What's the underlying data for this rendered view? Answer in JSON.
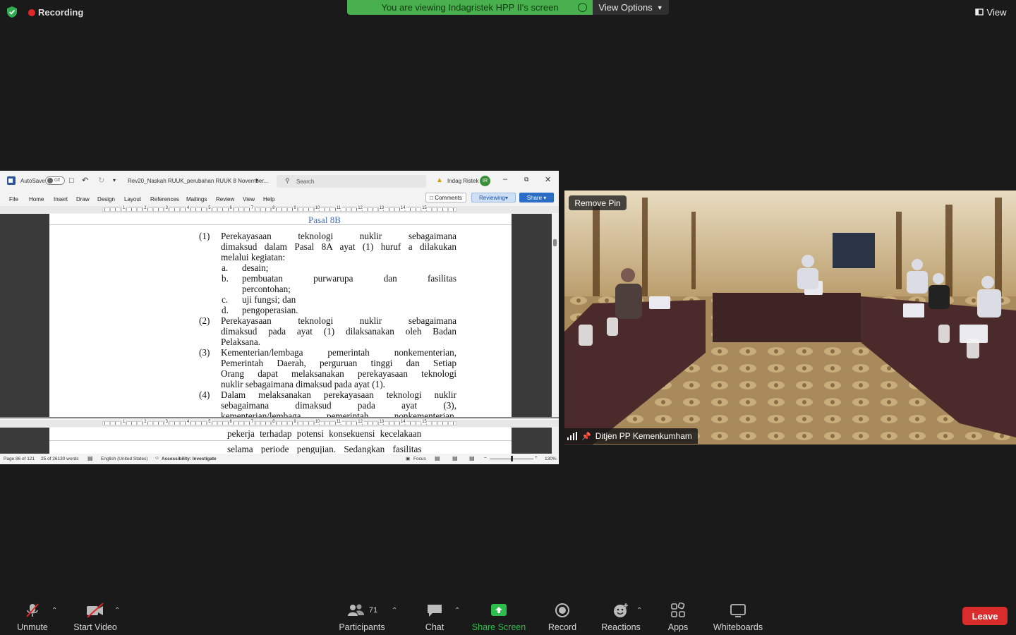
{
  "top": {
    "recording": "Recording",
    "banner": "You are viewing Indagristek HPP II's screen",
    "view_options": "View Options",
    "view": "View"
  },
  "word": {
    "autosave_label": "AutoSave",
    "autosave_state": "Off",
    "doc_title": "Rev20_Naskah RUUK_perubahan RUUK 8 November...",
    "search_placeholder": "Search",
    "user_name": "Indag Ristek",
    "user_initial": "IR",
    "menu": [
      "File",
      "Home",
      "Insert",
      "Draw",
      "Design",
      "Layout",
      "References",
      "Mailings",
      "Review",
      "View",
      "Help"
    ],
    "comments": "Comments",
    "reviewing": "Reviewing",
    "share": "Share",
    "ruler_numbers": [
      "1",
      "2",
      "3",
      "4",
      "5",
      "6",
      "7",
      "8",
      "9",
      "10",
      "11",
      "12",
      "13",
      "14",
      "15"
    ],
    "heading": "Pasal 8B",
    "lower_pane": [
      "pekerja terhadap potensi konsekuensi kecelakaan",
      "selama periode pengujian. Sedangkan fasilitas"
    ],
    "status": {
      "page": "Page 86 of 121",
      "words": "25 of 26130 words",
      "language": "English (United States)",
      "accessibility": "Accessibility: Investigate",
      "focus": "Focus",
      "zoom": "130%"
    }
  },
  "doc_lines": [
    {
      "n": "(1)",
      "t": "Perekayasaan teknologi nuklir sebagaimana",
      "j": true
    },
    {
      "n": "",
      "t": "dimaksud dalam Pasal 8A ayat (1) huruf a dilakukan",
      "j": true
    },
    {
      "n": "",
      "t": "melalui kegiatan:",
      "j": false
    },
    {
      "n": "",
      "l": "a.",
      "t": "desain;",
      "j": false
    },
    {
      "n": "",
      "l": "b.",
      "t": "pembuatan purwarupa dan fasilitas",
      "j": true
    },
    {
      "n": "",
      "l": "",
      "t": "percontohan;",
      "j": false
    },
    {
      "n": "",
      "l": "c.",
      "t": "uji fungsi; dan",
      "j": false
    },
    {
      "n": "",
      "l": "d.",
      "t": "pengoperasian.",
      "j": false
    },
    {
      "n": "(2)",
      "t": "Perekayasaan teknologi nuklir sebagaimana",
      "j": true
    },
    {
      "n": "",
      "t": "dimaksud pada ayat (1) dilaksanakan oleh Badan",
      "j": true
    },
    {
      "n": "",
      "t": "Pelaksana.",
      "j": false
    },
    {
      "n": "(3)",
      "t": "Kementerian/lembaga pemerintah nonkementerian,",
      "j": true
    },
    {
      "n": "",
      "t": "Pemerintah Daerah, perguruan tinggi dan Setiap",
      "j": true
    },
    {
      "n": "",
      "t": "Orang dapat melaksanakan perekayasaan teknologi",
      "j": true
    },
    {
      "n": "",
      "t": "nuklir sebagaimana dimaksud pada ayat (1).",
      "j": false
    },
    {
      "n": "(4)",
      "t": "Dalam melaksanakan perekayasaan teknologi nuklir",
      "j": true
    },
    {
      "n": "",
      "t": "sebagaimana dimaksud pada ayat (3),",
      "j": true
    },
    {
      "n": "",
      "t": "kementerian/lembaga pemerintah nonkementerian,",
      "j": true
    }
  ],
  "video": {
    "remove_pin": "Remove Pin",
    "participant_name": "Ditjen PP Kemenkumham"
  },
  "toolbar": {
    "unmute": "Unmute",
    "start_video": "Start Video",
    "participants": "Participants",
    "participants_count": "71",
    "chat": "Chat",
    "share_screen": "Share Screen",
    "record": "Record",
    "reactions": "Reactions",
    "apps": "Apps",
    "whiteboards": "Whiteboards",
    "leave": "Leave"
  },
  "colors": {
    "banner": "#48b04c",
    "share_green": "#2dbd4c",
    "leave": "#d92d2d",
    "word_link": "#2f5597"
  }
}
